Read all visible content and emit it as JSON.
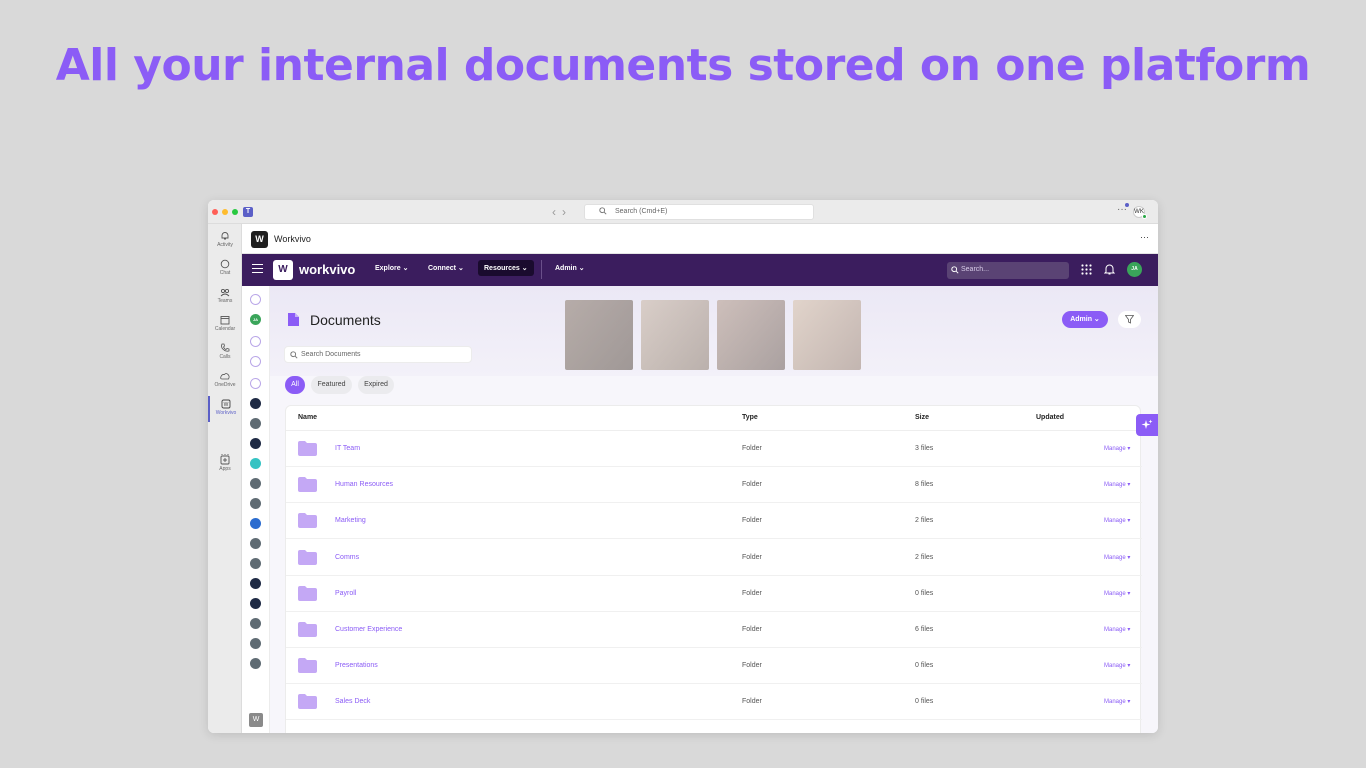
{
  "headline": "All your internal documents stored on one platform",
  "titlebar": {
    "search_placeholder": "Search (Cmd+E)",
    "more_label": "···",
    "avatar_initials": "WK"
  },
  "rail": {
    "items": [
      {
        "label": "Activity",
        "icon": "bell-icon"
      },
      {
        "label": "Chat",
        "icon": "chat-icon"
      },
      {
        "label": "Teams",
        "icon": "teams-icon"
      },
      {
        "label": "Calendar",
        "icon": "calendar-icon"
      },
      {
        "label": "Calls",
        "icon": "phone-icon"
      },
      {
        "label": "OneDrive",
        "icon": "cloud-icon"
      },
      {
        "label": "Workvivo",
        "icon": "workvivo-icon"
      },
      {
        "label": "Apps",
        "icon": "plus-icon"
      }
    ],
    "more": "···"
  },
  "app_header": {
    "title": "Workvivo",
    "more": "···"
  },
  "nav": {
    "brand": "workvivo",
    "items": [
      "Explore",
      "Connect",
      "Resources",
      "Admin"
    ],
    "active": "Resources",
    "search_placeholder": "Search...",
    "avatar_initials": "JA"
  },
  "col2": {
    "avatar_initials": "JA"
  },
  "documents": {
    "title": "Documents",
    "admin_button": "Admin",
    "search_placeholder": "Search Documents",
    "filters": [
      "All",
      "Featured",
      "Expired"
    ],
    "active_filter": "All",
    "columns": [
      "Name",
      "Type",
      "Size",
      "Updated"
    ],
    "rows": [
      {
        "name": "IT Team",
        "type": "Folder",
        "size": "3 files",
        "manage": "Manage ▾"
      },
      {
        "name": "Human Resources",
        "type": "Folder",
        "size": "8 files",
        "manage": "Manage ▾"
      },
      {
        "name": "Marketing",
        "type": "Folder",
        "size": "2 files",
        "manage": "Manage ▾"
      },
      {
        "name": "Comms",
        "type": "Folder",
        "size": "2 files",
        "manage": "Manage ▾"
      },
      {
        "name": "Payroll",
        "type": "Folder",
        "size": "0 files",
        "manage": "Manage ▾"
      },
      {
        "name": "Customer Experience",
        "type": "Folder",
        "size": "6 files",
        "manage": "Manage ▾"
      },
      {
        "name": "Presentations",
        "type": "Folder",
        "size": "0 files",
        "manage": "Manage ▾"
      },
      {
        "name": "Sales Deck",
        "type": "Folder",
        "size": "0 files",
        "manage": "Manage ▾"
      }
    ]
  },
  "colors": {
    "accent": "#8b5cf6",
    "nav_bg": "#3b1d5e",
    "background": "#d9d9d9"
  }
}
